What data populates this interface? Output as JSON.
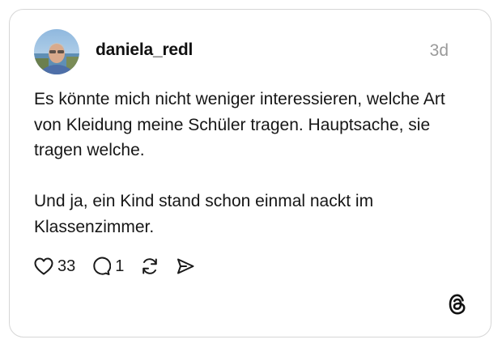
{
  "post": {
    "username": "daniela_redl",
    "timestamp": "3d",
    "paragraphs": [
      "Es könnte mich nicht weniger interessieren, welche Art von Kleidung meine Schüler tragen. Hauptsache, sie tragen welche.",
      "Und ja, ein Kind stand schon einmal nackt im Klassenzimmer."
    ]
  },
  "actions": {
    "likes": "33",
    "replies": "1"
  },
  "icons": {
    "like": "heart-icon",
    "reply": "comment-icon",
    "repost": "repost-icon",
    "share": "send-icon",
    "brand": "threads-logo-icon"
  },
  "colors": {
    "text": "#161616",
    "muted": "#9a9a9a",
    "border": "#d6d6d6"
  }
}
